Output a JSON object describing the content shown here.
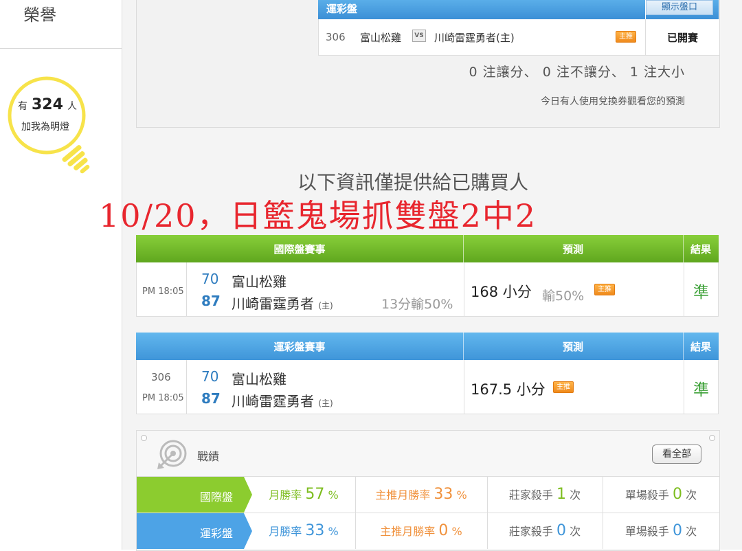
{
  "sidebar": {
    "honor_title": "榮譽",
    "bulb": {
      "prefix": "有",
      "count": "324",
      "suffix": "人",
      "caption": "加我為明燈"
    }
  },
  "lottery_panel": {
    "title": "運彩盤",
    "show_button": "顯示盤口",
    "game": {
      "number": "306",
      "away": "富山松雞",
      "vs": "VS",
      "home": "川崎雷霆勇者(主)",
      "badge": "主推",
      "status": "已開賽"
    },
    "counts": "0 注讓分、 0 注不讓分、 1 注大小",
    "voucher_note": "今日有人使用兌換券觀看您的預測"
  },
  "buyers_note": "以下資訊僅提供給已購買人",
  "overlay_text": "10/20，日籃鬼場抓雙盤2中2",
  "international_table": {
    "header": {
      "event": "國際盤賽事",
      "prediction": "預測",
      "result": "結果"
    },
    "time": "PM 18:05",
    "away": {
      "score": "70",
      "team": "富山松雞"
    },
    "home": {
      "score": "87",
      "team": "川崎雷霆勇者",
      "home_tag": "(主)"
    },
    "spread": "13分輸50%",
    "prediction": "168 小分",
    "prediction_sub": "輸50%",
    "badge": "主推",
    "result": "準"
  },
  "lottery_table": {
    "header": {
      "event": "運彩盤賽事",
      "prediction": "預測",
      "result": "結果"
    },
    "number": "306",
    "time": "PM 18:05",
    "away": {
      "score": "70",
      "team": "富山松雞"
    },
    "home": {
      "score": "87",
      "team": "川崎雷霆勇者",
      "home_tag": "(主)"
    },
    "prediction": "167.5 小分",
    "badge": "主推",
    "result": "準"
  },
  "record": {
    "title": "戰績",
    "view_all": "看全部",
    "rows": [
      {
        "label": "國際盤",
        "monthly_label": "月勝率",
        "monthly_value": "57",
        "monthly_unit": "%",
        "main_label": "主推月勝率",
        "main_value": "33",
        "main_unit": "%",
        "dealer_label": "莊家殺手",
        "dealer_value": "1",
        "dealer_unit": "次",
        "single_label": "單場殺手",
        "single_value": "0",
        "single_unit": "次"
      },
      {
        "label": "運彩盤",
        "monthly_label": "月勝率",
        "monthly_value": "33",
        "monthly_unit": "%",
        "main_label": "主推月勝率",
        "main_value": "0",
        "main_unit": "%",
        "dealer_label": "莊家殺手",
        "dealer_value": "0",
        "dealer_unit": "次",
        "single_label": "單場殺手",
        "single_value": "0",
        "single_unit": "次"
      }
    ]
  },
  "colors": {
    "green": "#8ccc2f",
    "blue": "#4da3e6",
    "orange": "#f0913c",
    "red_overlay": "#e8262e",
    "bulb_yellow": "#f7e34a"
  }
}
